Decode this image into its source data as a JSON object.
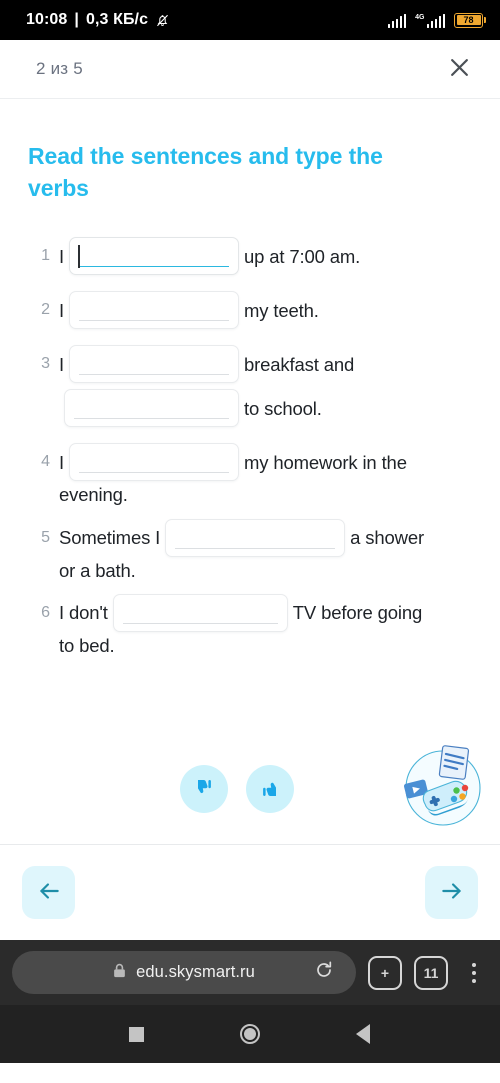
{
  "status_bar": {
    "time": "10:08",
    "separator": "|",
    "data_rate": "0,3 КБ/с",
    "mute_icon": "bell-muted-icon",
    "network_type": "4G",
    "battery_percent": "78",
    "battery_color": "#f0a830"
  },
  "app_header": {
    "progress": "2 из 5",
    "close_icon": "close-icon"
  },
  "task": {
    "title": "Read the sentences and type the verbs",
    "title_color": "#27bced",
    "questions": [
      {
        "number": "1",
        "parts": [
          {
            "type": "text",
            "value": "I"
          },
          {
            "type": "blank",
            "width": "w-170",
            "focused": true,
            "value": ""
          },
          {
            "type": "text",
            "value": "up at 7:00 am."
          }
        ]
      },
      {
        "number": "2",
        "parts": [
          {
            "type": "text",
            "value": "I"
          },
          {
            "type": "blank",
            "width": "w-170",
            "focused": false,
            "value": ""
          },
          {
            "type": "text",
            "value": "my teeth."
          }
        ]
      },
      {
        "number": "3",
        "parts": [
          {
            "type": "text",
            "value": "I"
          },
          {
            "type": "blank",
            "width": "w-170",
            "focused": false,
            "value": ""
          },
          {
            "type": "text",
            "value": "breakfast and"
          },
          {
            "type": "break"
          },
          {
            "type": "blank",
            "width": "w-175",
            "focused": false,
            "value": ""
          },
          {
            "type": "text",
            "value": "to school."
          }
        ]
      },
      {
        "number": "4",
        "parts": [
          {
            "type": "text",
            "value": "I"
          },
          {
            "type": "blank",
            "width": "w-170",
            "focused": false,
            "value": ""
          },
          {
            "type": "text",
            "value": "my homework in the"
          },
          {
            "type": "break"
          },
          {
            "type": "text",
            "value": "evening."
          }
        ]
      },
      {
        "number": "5",
        "parts": [
          {
            "type": "text",
            "value": "Sometimes I"
          },
          {
            "type": "blank",
            "width": "w-180",
            "focused": false,
            "value": ""
          },
          {
            "type": "text",
            "value": "a shower"
          },
          {
            "type": "break"
          },
          {
            "type": "text",
            "value": "or a bath."
          }
        ]
      },
      {
        "number": "6",
        "parts": [
          {
            "type": "text",
            "value": "I don't"
          },
          {
            "type": "blank",
            "width": "w-175",
            "focused": false,
            "value": ""
          },
          {
            "type": "text",
            "value": "TV before going"
          },
          {
            "type": "break"
          },
          {
            "type": "text",
            "value": "to bed."
          }
        ]
      }
    ]
  },
  "feedback": {
    "dislike_icon": "thumbs-down-icon",
    "like_icon": "thumbs-up-icon",
    "mascot_icon": "gamepad-document-play-icon",
    "circle_color": "#ccf2fb",
    "thumb_color": "#1aa7e8"
  },
  "navigation": {
    "prev_icon": "arrow-left-icon",
    "next_icon": "arrow-right-icon",
    "button_bg": "#dff6fc",
    "arrow_color": "#1f8ea8"
  },
  "browser": {
    "lock_icon": "lock-icon",
    "url": "edu.skysmart.ru",
    "reload_icon": "reload-icon",
    "new_tab_label": "+",
    "tab_count": "11",
    "menu_icon": "overflow-menu-icon"
  },
  "android_nav": {
    "recents_icon": "square-recents-icon",
    "home_icon": "circle-home-icon",
    "back_icon": "triangle-back-icon"
  }
}
